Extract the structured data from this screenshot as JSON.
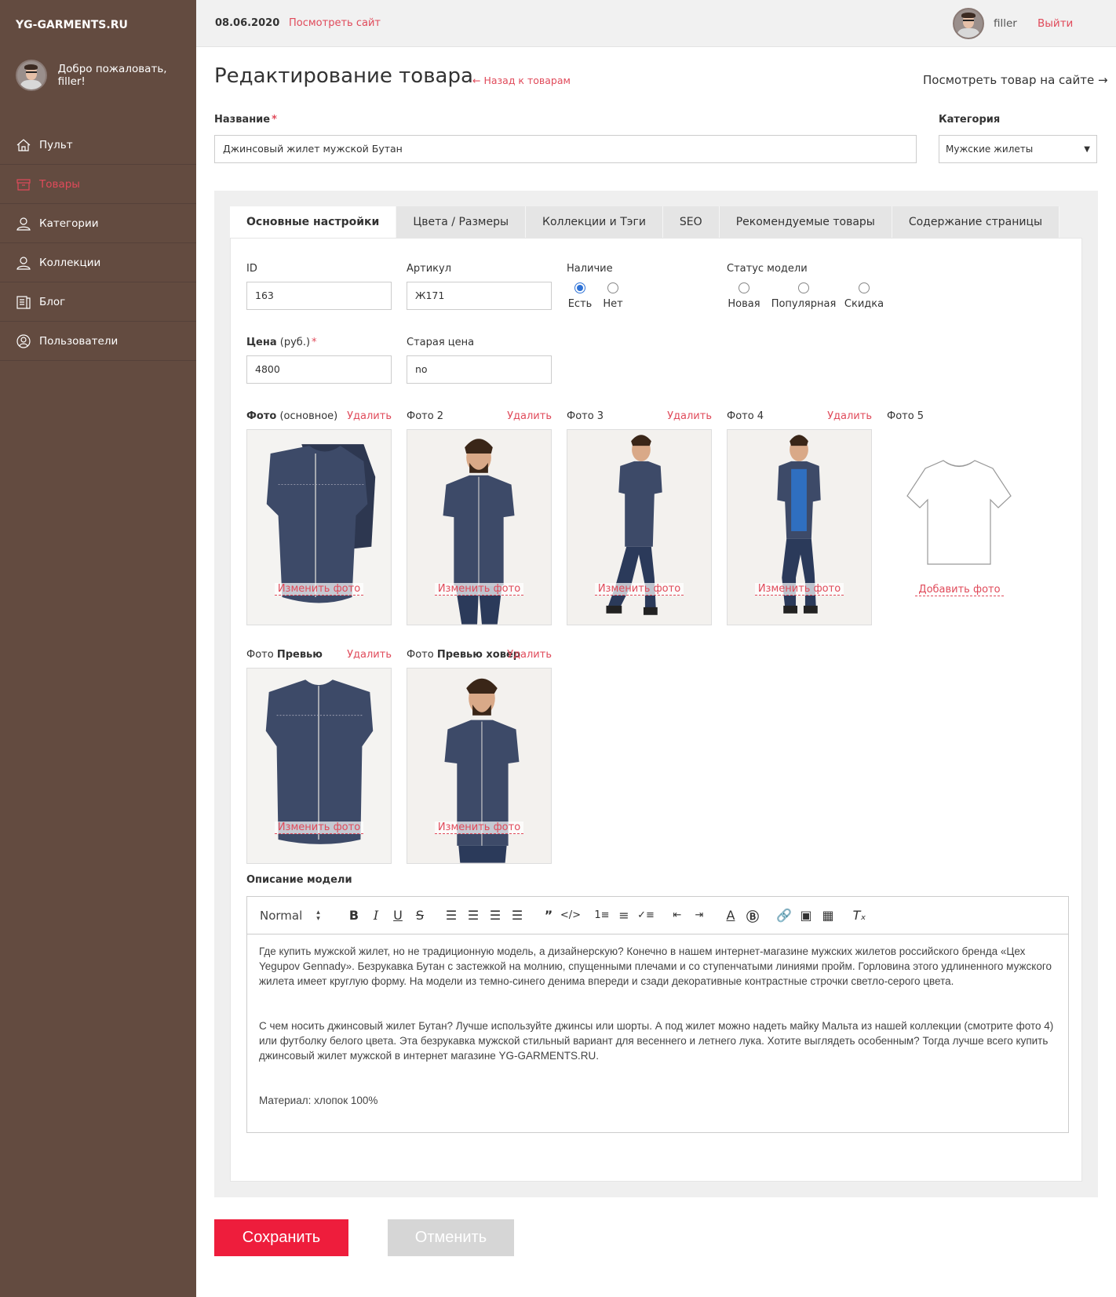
{
  "sidebar": {
    "brand": "YG-GARMENTS.RU",
    "welcome": "Добро пожаловать, filler!",
    "items": [
      {
        "label": "Пульт",
        "icon": "home-icon"
      },
      {
        "label": "Товары",
        "icon": "box-icon"
      },
      {
        "label": "Категории",
        "icon": "person-icon"
      },
      {
        "label": "Коллекции",
        "icon": "person-icon"
      },
      {
        "label": "Блог",
        "icon": "book-icon"
      },
      {
        "label": "Пользователи",
        "icon": "user-circle-icon"
      }
    ],
    "active_item": "Товары"
  },
  "topbar": {
    "date": "08.06.2020",
    "view_site": "Посмотреть сайт",
    "username": "filler",
    "logout": "Выйти"
  },
  "header": {
    "title": "Редактирование товара",
    "back_link": "← Назад к товарам",
    "view_product": "Посмотреть товар на сайте →"
  },
  "form": {
    "name_label": "Название",
    "name_value": "Джинсовый жилет мужской Бутан",
    "category_label": "Категория",
    "category_value": "Мужские жилеты",
    "required_mark": "*"
  },
  "tabs": [
    "Основные настройки",
    "Цвета / Размеры",
    "Коллекции и Тэги",
    "SEO",
    "Рекомендуемые товары",
    "Содержание страницы"
  ],
  "basic": {
    "id_label": "ID",
    "id_value": "163",
    "sku_label": "Артикул",
    "sku_value": "Ж171",
    "stock_label": "Наличие",
    "stock_options": [
      "Есть",
      "Нет"
    ],
    "stock_selected": "Есть",
    "status_label": "Статус модели",
    "status_options": [
      "Новая",
      "Популярная",
      "Скидка"
    ],
    "price_label": "Цена",
    "price_unit": "(руб.)",
    "price_value": "4800",
    "old_price_label": "Старая цена",
    "old_price_value": "no"
  },
  "photos": {
    "delete": "Удалить",
    "change": "Изменить фото",
    "add": "Добавить фото",
    "main_bold": "Фото",
    "main_rest": "(основное)",
    "photo2": "Фото 2",
    "photo3": "Фото 3",
    "photo4": "Фото 4",
    "photo5": "Фото 5",
    "preview_pre": "Фото",
    "preview_bold": "Превью",
    "hover_pre": "Фото",
    "hover_bold": "Превью ховер"
  },
  "description": {
    "label": "Описание модели",
    "format": "Normal",
    "paragraphs": [
      "Где купить мужской жилет, но не традиционную модель, а дизайнерскую? Конечно в нашем интернет-магазине мужских жилетов российского бренда «Цех Yegupov Gennady». Безрукавка Бутан с застежкой на молнию, спущенными плечами и со ступенчатыми линиями пройм. Горловина этого удлиненного мужского жилета имеет круглую форму. На модели из темно-синего денима впереди и сзади декоративные контрастные строчки светло-серого цвета.",
      "С чем носить джинсовый жилет Бутан? Лучше используйте джинсы или шорты. А под жилет можно надеть майку Мальта из нашей коллекции (смотрите фото 4) или футболку белого цвета. Эта безрукавка мужской стильный вариант для весеннего и летнего лука. Хотите выглядеть особенным? Тогда лучше всего купить джинсовый жилет мужской в интернет магазине YG-GARMENTS.RU.",
      "Материал: хлопок 100%"
    ]
  },
  "actions": {
    "save": "Сохранить",
    "cancel": "Отменить"
  },
  "colors": {
    "sidebar": "#634b40",
    "accent": "#e04a5a",
    "save": "#ee1d3c",
    "cancel": "#d6d6d6",
    "denim": "#3a4560"
  }
}
